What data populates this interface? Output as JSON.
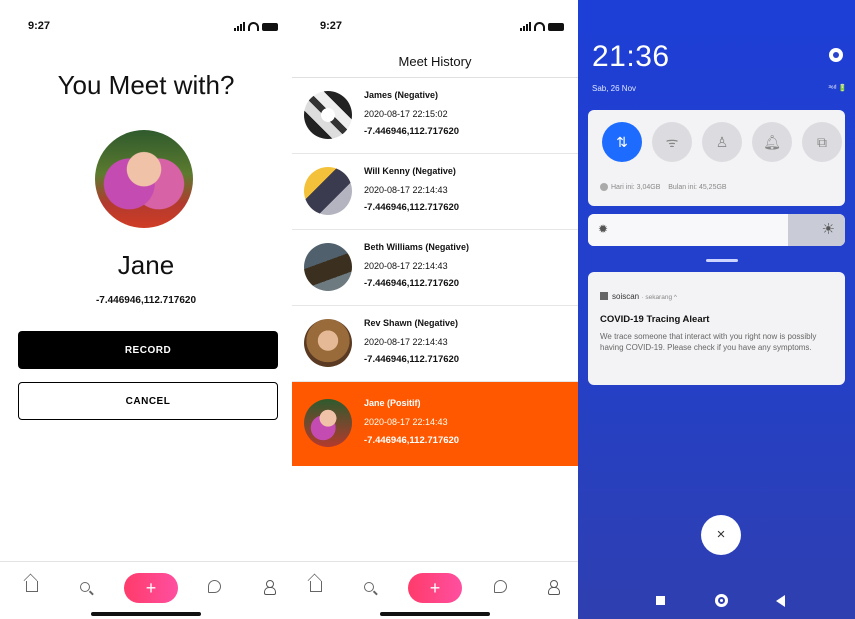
{
  "panel1": {
    "status_time": "9:27",
    "title": "You Meet with?",
    "name": "Jane",
    "coords": "-7.446946,112.717620",
    "record_label": "RECORD",
    "cancel_label": "CANCEL",
    "fab_label": "+"
  },
  "panel2": {
    "status_time": "9:27",
    "title": "Meet History",
    "fab_label": "+",
    "items": [
      {
        "name": "James (Negative)",
        "datetime": "2020-08-17 22:15:02",
        "coords": "-7.446946,112.717620"
      },
      {
        "name": "Will Kenny (Negative)",
        "datetime": "2020-08-17 22:14:43",
        "coords": "-7.446946,112.717620"
      },
      {
        "name": "Beth Williams (Negative)",
        "datetime": "2020-08-17 22:14:43",
        "coords": "-7.446946,112.717620"
      },
      {
        "name": "Rev Shawn (Negative)",
        "datetime": "2020-08-17 22:14:43",
        "coords": "-7.446946,112.717620"
      },
      {
        "name": "Jane (Positif)",
        "datetime": "2020-08-17 22:14:43",
        "coords": "-7.446946,112.717620",
        "highlight_color": "#ff5800"
      }
    ]
  },
  "panel3": {
    "time": "21:36",
    "date": "Sab, 26 Nov",
    "indicators": "³⁶ᵈ 🔋",
    "data_today": "Hari ini: 3,04GB",
    "data_month": "Bulan ini: 45,25GB",
    "brightness": 0.78,
    "notification": {
      "app": "soiscan",
      "when": "· sekarang ^",
      "title": "COVID-19 Tracing Aleart",
      "body": "We trace someone that interact with you right now is possibly having COVID-19. Please check if you have any symptoms."
    },
    "close_label": "×"
  },
  "colors": {
    "accent_orange": "#ff5800",
    "fab_pink": "#ff3b6b",
    "toggle_blue": "#1e6bff",
    "android_bg": "#2340c9"
  }
}
